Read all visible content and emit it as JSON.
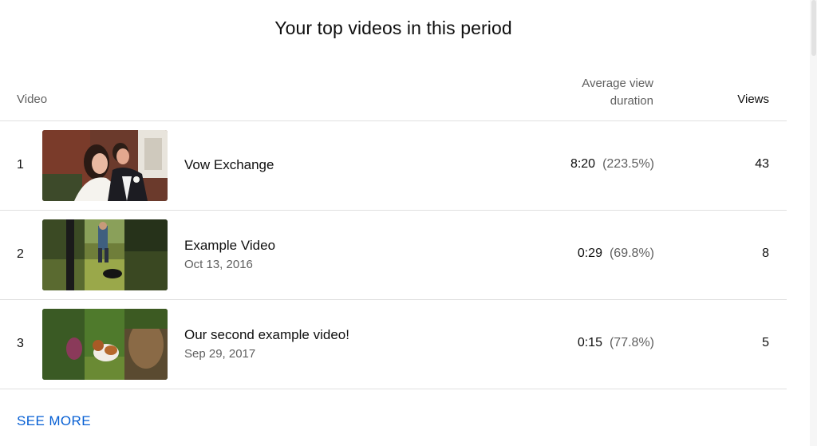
{
  "title": "Your top videos in this period",
  "columns": {
    "video": "Video",
    "avg_view_duration_line1": "Average view",
    "avg_view_duration_line2": "duration",
    "views": "Views"
  },
  "videos": [
    {
      "rank": "1",
      "title": "Vow Exchange",
      "date": "",
      "avg_duration": "8:20",
      "avg_percent": "(223.5%)",
      "views": "43"
    },
    {
      "rank": "2",
      "title": "Example Video",
      "date": "Oct 13, 2016",
      "avg_duration": "0:29",
      "avg_percent": "(69.8%)",
      "views": "8"
    },
    {
      "rank": "3",
      "title": "Our second example video!",
      "date": "Sep 29, 2017",
      "avg_duration": "0:15",
      "avg_percent": "(77.8%)",
      "views": "5"
    }
  ],
  "see_more": "SEE MORE",
  "colors": {
    "link": "#065fd4",
    "secondary_text": "#606060",
    "divider": "#e0e0e0"
  }
}
